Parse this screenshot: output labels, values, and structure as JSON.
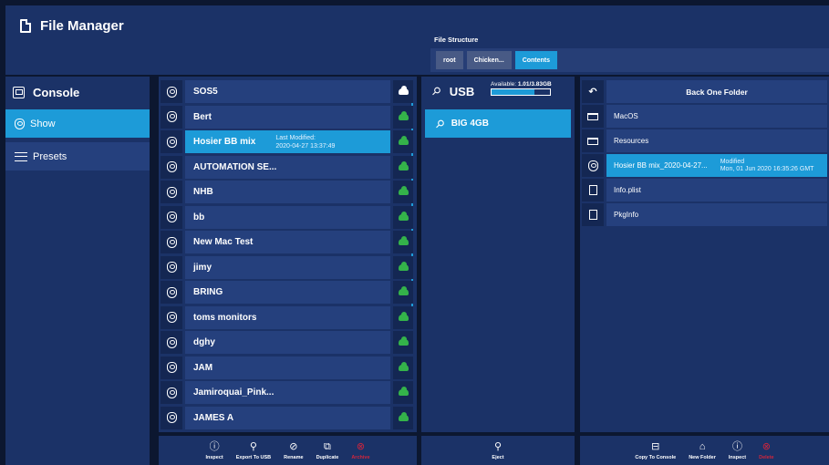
{
  "app": {
    "title": "File Manager"
  },
  "file_structure": {
    "label": "File Structure",
    "crumbs": [
      "root",
      "Chicken...",
      "Contents"
    ],
    "active_crumb": 2
  },
  "nav": {
    "console_label": "Console",
    "items": [
      {
        "label": "Show",
        "selected": true,
        "icon": "show-icon"
      },
      {
        "label": "Presets",
        "selected": false,
        "icon": "presets-icon"
      }
    ]
  },
  "shows": [
    {
      "name": "SOS5",
      "cloud": "white"
    },
    {
      "name": "Bert",
      "cloud": "green"
    },
    {
      "name": "Hosier BB mix",
      "cloud": "green",
      "selected": true,
      "modified_label": "Last Modified:",
      "modified": "2020-04-27 13:37:49"
    },
    {
      "name": "AUTOMATION SE...",
      "cloud": "green"
    },
    {
      "name": "NHB",
      "cloud": "green"
    },
    {
      "name": "bb",
      "cloud": "green"
    },
    {
      "name": "New Mac Test",
      "cloud": "green"
    },
    {
      "name": "jimy",
      "cloud": "green"
    },
    {
      "name": "BRING",
      "cloud": "green"
    },
    {
      "name": "toms monitors",
      "cloud": "green"
    },
    {
      "name": "dghy",
      "cloud": "green"
    },
    {
      "name": "JAM",
      "cloud": "green"
    },
    {
      "name": "Jamiroquai_Pink...",
      "cloud": "green"
    },
    {
      "name": "JAMES A",
      "cloud": "green"
    }
  ],
  "show_actions": [
    {
      "label": "Inspect",
      "icon": "info-icon",
      "glyph": "ⓘ"
    },
    {
      "label": "Export To USB",
      "icon": "usb-icon",
      "glyph": "⚲"
    },
    {
      "label": "Rename",
      "icon": "rename-icon",
      "glyph": "⊘"
    },
    {
      "label": "Duplicate",
      "icon": "duplicate-icon",
      "glyph": "⧉"
    },
    {
      "label": "Archive",
      "icon": "archive-icon",
      "glyph": "⊗",
      "danger": true
    }
  ],
  "usb": {
    "title": "USB",
    "available_label": "Available:",
    "available_value": "1.01/3.83GB",
    "used_fraction": 0.74,
    "device": "BIG 4GB",
    "eject_label": "Eject"
  },
  "fs": {
    "back_label": "Back One Folder",
    "entries": [
      {
        "name": "MacOS",
        "type": "folder"
      },
      {
        "name": "Resources",
        "type": "folder"
      },
      {
        "name": "Hosier BB mix_2020-04-27...",
        "type": "show",
        "selected": true,
        "modified_label": "Modified",
        "modified": "Mon, 01 Jun 2020 16:35:26 GMT"
      },
      {
        "name": "Info.plist",
        "type": "file"
      },
      {
        "name": "PkgInfo",
        "type": "file"
      }
    ]
  },
  "fs_actions": [
    {
      "label": "Copy To Console",
      "icon": "copy-to-console-icon",
      "glyph": "⊟"
    },
    {
      "label": "New Folder",
      "icon": "folder-icon",
      "glyph": "⌂"
    },
    {
      "label": "Inspect",
      "icon": "info-icon",
      "glyph": "ⓘ"
    },
    {
      "label": "Delete",
      "icon": "delete-icon",
      "glyph": "⊗",
      "danger": true
    }
  ],
  "colors": {
    "accent": "#1d9bd8",
    "panel": "#1b3267",
    "background": "#0c1730",
    "cloud_green": "#34b34a",
    "danger": "#d0253c"
  }
}
